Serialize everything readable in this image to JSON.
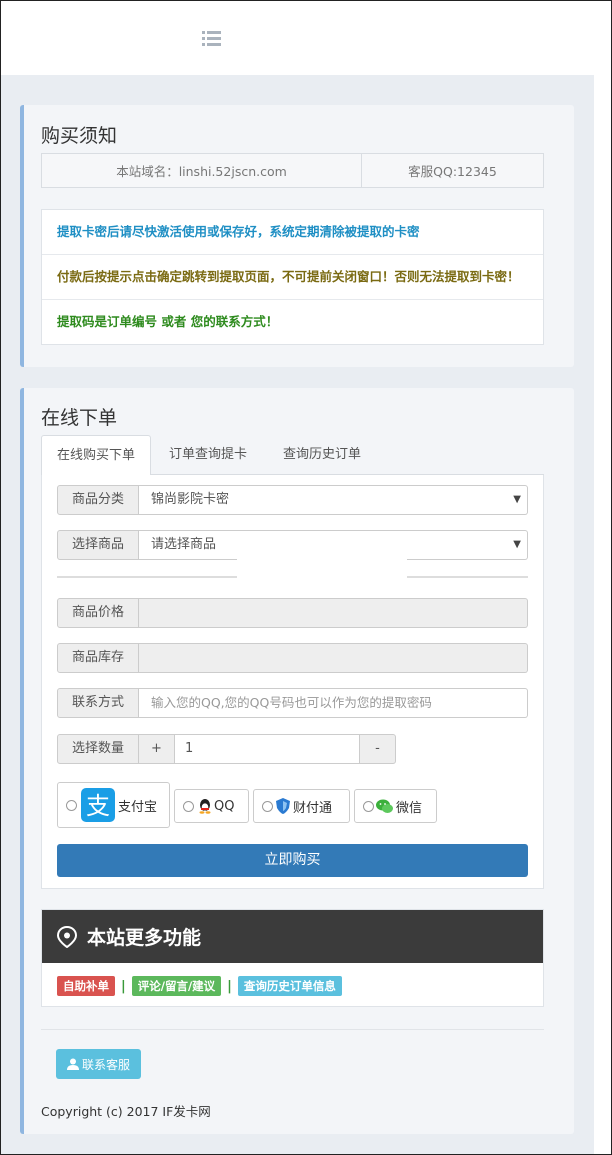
{
  "header": {
    "menu_icon": "list-icon"
  },
  "notice_card": {
    "title": "购买须知",
    "domain_text": "本站域名：linshi.52jscn.com",
    "qq_text": "客服QQ:12345",
    "notices": [
      "提取卡密后请尽快激活使用或保存好，系统定期清除被提取的卡密",
      "付款后按提示点击确定跳转到提取页面，不可提前关闭窗口！否则无法提取到卡密！",
      "提取码是订单编号 或者 您的联系方式！"
    ]
  },
  "order_card": {
    "title": "在线下单",
    "tabs": [
      "在线购买下单",
      "订单查询提卡",
      "查询历史订单"
    ],
    "category_label": "商品分类",
    "category_value": "锦尚影院卡密",
    "product_label": "选择商品",
    "product_value": "请选择商品",
    "price_label": "商品价格",
    "stock_label": "商品库存",
    "contact_label": "联系方式",
    "contact_placeholder": "输入您的QQ,您的QQ号码也可以作为您的提取密码",
    "qty_label": "选择数量",
    "qty_plus": "+",
    "qty_value": "1",
    "qty_minus": "-",
    "payments": [
      "支付宝",
      "QQ",
      "财付通",
      "微信"
    ],
    "buy_label": "立即购买"
  },
  "more": {
    "title": "本站更多功能",
    "links": [
      "自助补单",
      "评论/留言/建议",
      "查询历史订单信息"
    ],
    "link_colors": [
      "#d9534f",
      "#5cb85c",
      "#5bc0de"
    ],
    "separator": "|"
  },
  "contact_button": "联系客服",
  "copyright": "Copyright (c) 2017 IF发卡网",
  "colors": {
    "primary": "#337ab7",
    "accent_border": "#8fb6e0",
    "dark_head": "#3b3b3b"
  }
}
